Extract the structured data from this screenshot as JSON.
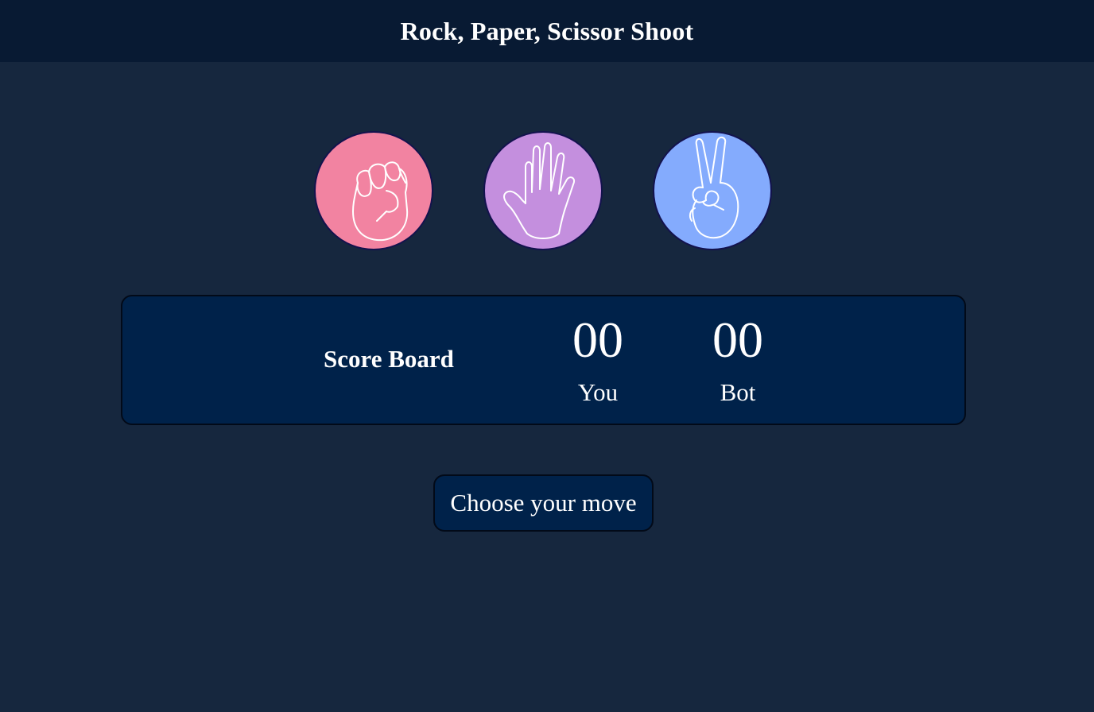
{
  "header": {
    "title": "Rock, Paper, Scissor Shoot"
  },
  "choices": [
    {
      "name": "rock",
      "icon": "fist-icon",
      "color": "#f283a1"
    },
    {
      "name": "paper",
      "icon": "open-hand-icon",
      "color": "#c48fde"
    },
    {
      "name": "scissors",
      "icon": "peace-hand-icon",
      "color": "#84abfd"
    }
  ],
  "scoreboard": {
    "title": "Score Board",
    "user_score": "00",
    "user_label": "You",
    "bot_score": "00",
    "bot_label": "Bot"
  },
  "message": {
    "text": "Choose your move"
  },
  "colors": {
    "background": "#16273e",
    "header_bg": "#081a33",
    "panel_bg": "#00224a",
    "text": "#ffffff"
  }
}
